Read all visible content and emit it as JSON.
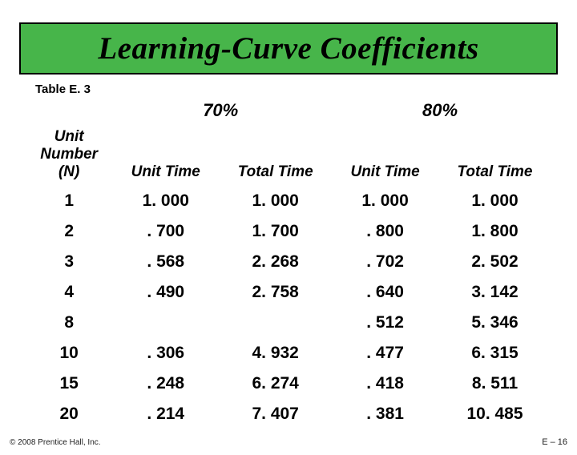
{
  "title": "Learning-Curve Coefficients",
  "table_label": "Table E. 3",
  "group_headers": {
    "g70": "70%",
    "g80": "80%"
  },
  "col_headers": {
    "unit": "Unit\nNumber\n(N)",
    "ut": "Unit Time",
    "tt": "Total Time"
  },
  "rows": [
    {
      "n": "1",
      "u70": "1. 000",
      "t70": "1. 000",
      "u80": "1. 000",
      "t80": "1. 000"
    },
    {
      "n": "2",
      "u70": ". 700",
      "t70": "1. 700",
      "u80": ". 800",
      "t80": "1. 800"
    },
    {
      "n": "3",
      "u70": ". 568",
      "t70": "2. 268",
      "u80": ". 702",
      "t80": "2. 502"
    },
    {
      "n": "4",
      "u70": ". 490",
      "t70": "2. 758",
      "u80": ". 640",
      "t80": "3. 142"
    },
    {
      "n": "8",
      "u70": "",
      "t70": "",
      "u80": ". 512",
      "t80": "5. 346"
    },
    {
      "n": "10",
      "u70": ". 306",
      "t70": "4. 932",
      "u80": ". 477",
      "t80": "6. 315"
    },
    {
      "n": "15",
      "u70": ". 248",
      "t70": "6. 274",
      "u80": ". 418",
      "t80": "8. 511"
    },
    {
      "n": "20",
      "u70": ". 214",
      "t70": "7. 407",
      "u80": ". 381",
      "t80": "10. 485"
    }
  ],
  "footer_left": "© 2008 Prentice Hall, Inc.",
  "footer_right": "E – 16",
  "chart_data": {
    "type": "table",
    "title": "Learning-Curve Coefficients",
    "columns": [
      "Unit Number (N)",
      "70% Unit Time",
      "70% Total Time",
      "80% Unit Time",
      "80% Total Time"
    ],
    "data": [
      [
        1,
        1.0,
        1.0,
        1.0,
        1.0
      ],
      [
        2,
        0.7,
        1.7,
        0.8,
        1.8
      ],
      [
        3,
        0.568,
        2.268,
        0.702,
        2.502
      ],
      [
        4,
        0.49,
        2.758,
        0.64,
        3.142
      ],
      [
        8,
        null,
        null,
        0.512,
        5.346
      ],
      [
        10,
        0.306,
        4.932,
        0.477,
        6.315
      ],
      [
        15,
        0.248,
        6.274,
        0.418,
        8.511
      ],
      [
        20,
        0.214,
        7.407,
        0.381,
        10.485
      ]
    ]
  }
}
